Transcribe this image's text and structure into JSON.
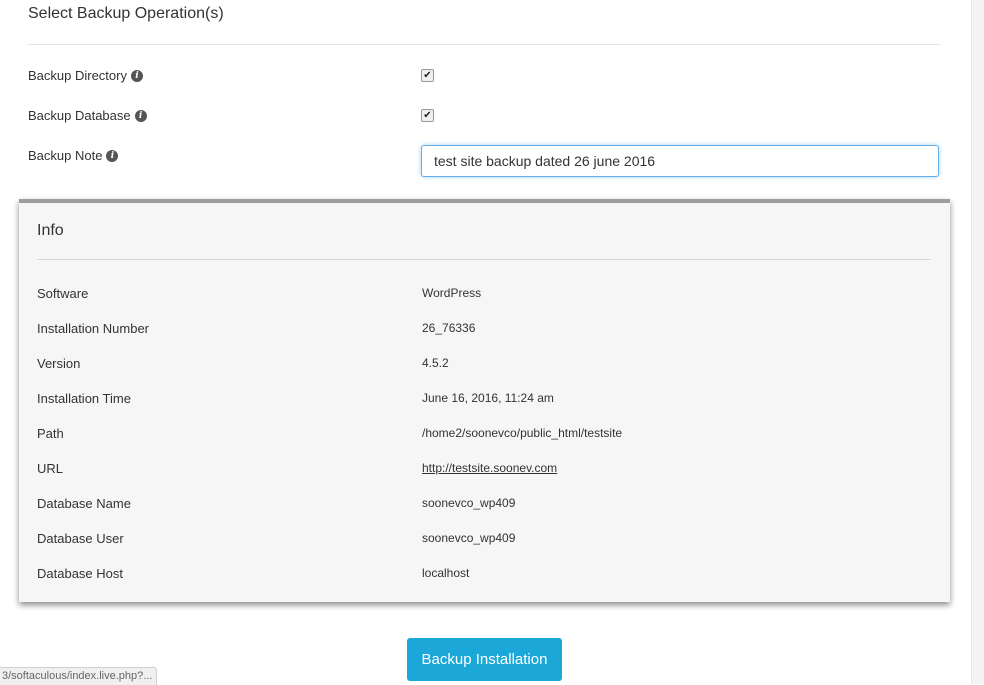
{
  "section": {
    "title": "Select Backup Operation(s)"
  },
  "options": [
    {
      "label": "Backup Directory",
      "checked": true,
      "check_glyph": "✔"
    },
    {
      "label": "Backup Database",
      "checked": true,
      "check_glyph": "✔"
    },
    {
      "label": "Backup Note"
    }
  ],
  "note": {
    "value": "test site backup dated 26 june 2016"
  },
  "info": {
    "title": "Info",
    "rows": [
      {
        "key": "Software",
        "value": "WordPress"
      },
      {
        "key": "Installation Number",
        "value": "26_76336"
      },
      {
        "key": "Version",
        "value": "4.5.2"
      },
      {
        "key": "Installation Time",
        "value": "June 16, 2016, 11:24 am"
      },
      {
        "key": "Path",
        "value": "/home2/soonevco/public_html/testsite"
      },
      {
        "key": "URL",
        "value": "http://testsite.soonev.com"
      },
      {
        "key": "Database Name",
        "value": "soonevco_wp409"
      },
      {
        "key": "Database User",
        "value": "soonevco_wp409"
      },
      {
        "key": "Database Host",
        "value": "localhost"
      }
    ]
  },
  "actions": {
    "backup_label": "Backup Installation"
  },
  "status_bar": {
    "text": "3/softaculous/index.live.php?..."
  },
  "colors": {
    "accent_button": "#1ba8d8",
    "input_focus": "#66afe9",
    "panel_border": "#9e9e9e"
  }
}
